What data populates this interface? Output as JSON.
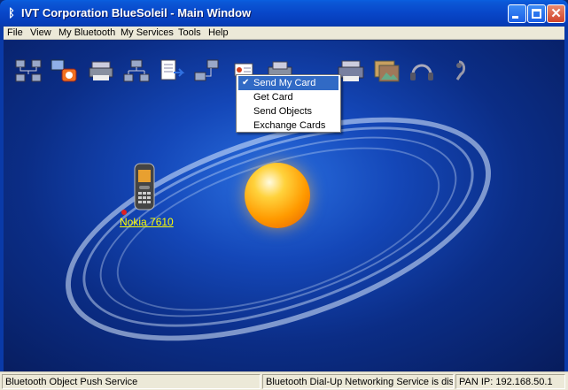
{
  "window": {
    "title": "IVT Corporation BlueSoleil - Main Window",
    "accent": "#0846c8"
  },
  "menubar": {
    "items": [
      "File",
      "View",
      "My Bluetooth",
      "My Services",
      "Tools",
      "Help"
    ]
  },
  "toolbar": {
    "icons": [
      "network-icon",
      "dialup-icon",
      "printer-icon",
      "lan-icon",
      "file-transfer-icon",
      "network-access-icon",
      "business-card-icon",
      "fax-icon",
      "print-icon",
      "image-icon",
      "headset-icon",
      "audio-gateway-icon"
    ]
  },
  "popup_menu": {
    "items": [
      {
        "label": "Send My Card",
        "selected": true,
        "checked": true
      },
      {
        "label": "Get Card",
        "selected": false,
        "checked": false
      },
      {
        "label": "Send Objects",
        "selected": false,
        "checked": false
      },
      {
        "label": "Exchange Cards",
        "selected": false,
        "checked": false
      }
    ],
    "check_mark": "✔"
  },
  "device": {
    "label": "Nokia 7610",
    "icon": "mobile-phone-icon"
  },
  "statusbar": {
    "cells": [
      "Bluetooth Object Push Service",
      "Bluetooth Dial-Up Networking Service is disconn",
      "PAN IP: 192.168.50.1"
    ]
  }
}
